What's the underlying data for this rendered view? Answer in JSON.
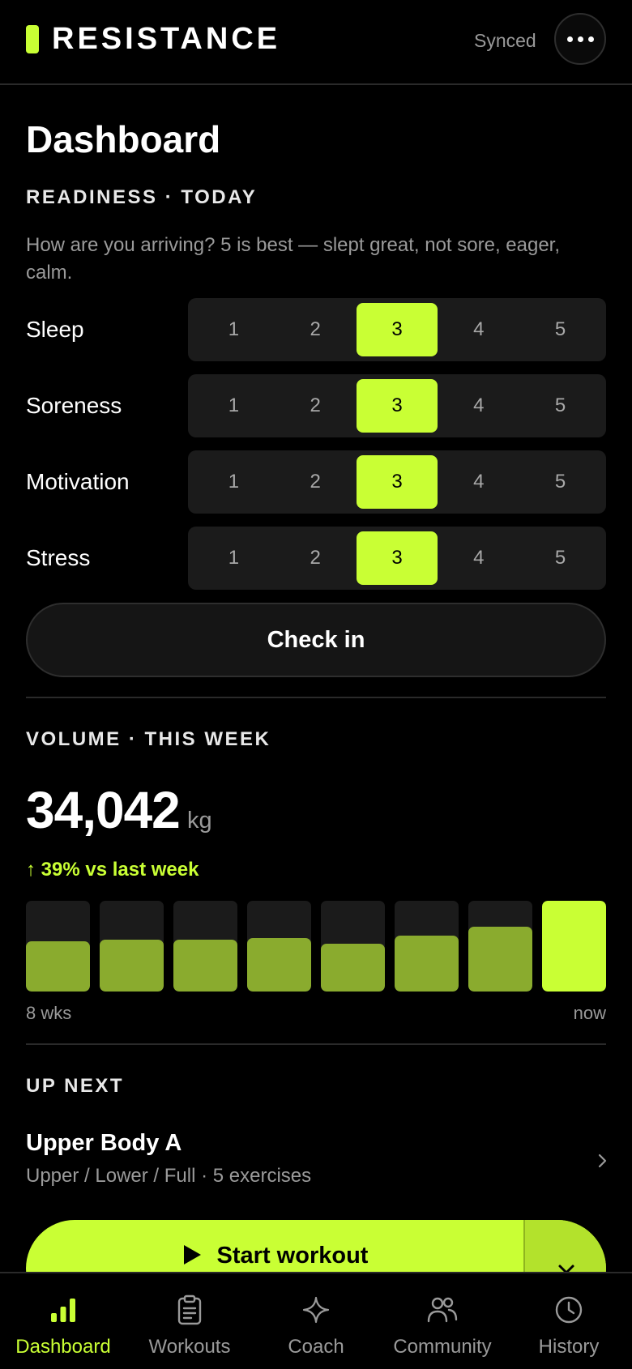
{
  "app": {
    "brand": "RESISTANCE",
    "sync_status": "Synced",
    "accent": "#c9ff34"
  },
  "page": {
    "title": "Dashboard"
  },
  "readiness": {
    "label": "READINESS · TODAY",
    "description": "How are you arriving? 5 is best — slept great, not sore, eager, calm.",
    "scale": [
      "1",
      "2",
      "3",
      "4",
      "5"
    ],
    "rows": [
      {
        "label": "Sleep",
        "selected": 3
      },
      {
        "label": "Soreness",
        "selected": 3
      },
      {
        "label": "Motivation",
        "selected": 3
      },
      {
        "label": "Stress",
        "selected": 3
      }
    ],
    "checkin_label": "Check in"
  },
  "volume": {
    "label": "VOLUME · THIS WEEK",
    "value": "34,042",
    "unit": "kg",
    "delta": "↑ 39% vs last week",
    "start_caption": "8 wks",
    "end_caption": "now",
    "weekly_fraction": [
      0.55,
      0.57,
      0.57,
      0.59,
      0.53,
      0.62,
      0.71,
      1.0
    ]
  },
  "up_next": {
    "label": "UP NEXT",
    "title": "Upper Body A",
    "subtitle": "Upper / Lower / Full · 5 exercises",
    "start_label": "Start workout"
  },
  "tabs": [
    {
      "label": "Dashboard",
      "icon": "bar-chart-icon",
      "active": true
    },
    {
      "label": "Workouts",
      "icon": "clipboard-icon",
      "active": false
    },
    {
      "label": "Coach",
      "icon": "sparkle-icon",
      "active": false
    },
    {
      "label": "Community",
      "icon": "people-icon",
      "active": false
    },
    {
      "label": "History",
      "icon": "clock-icon",
      "active": false
    }
  ]
}
